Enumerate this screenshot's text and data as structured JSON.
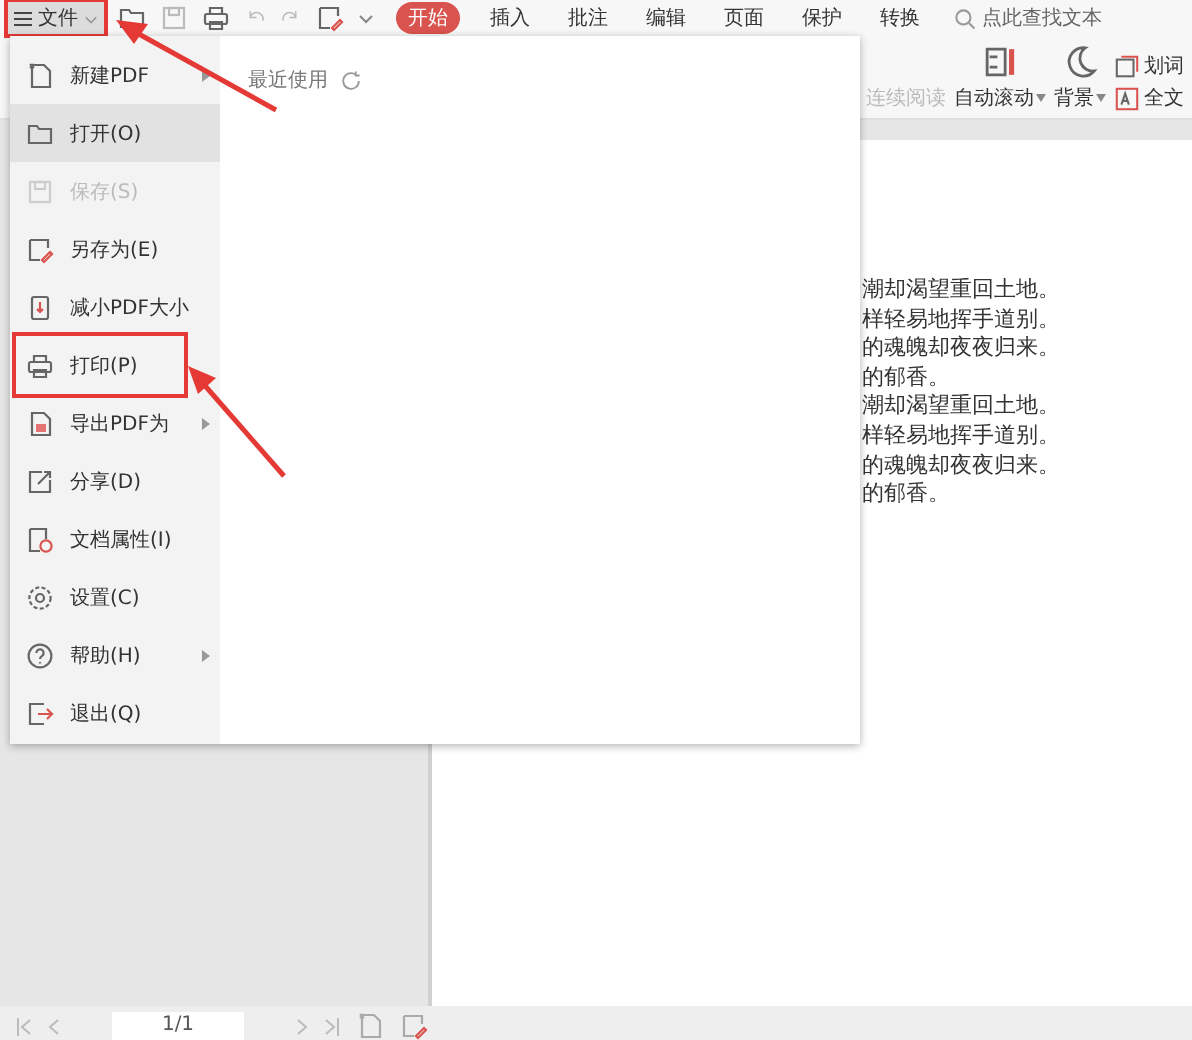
{
  "toolbar": {
    "file_button": {
      "label": "文件",
      "highlighted": true
    },
    "tabs": [
      {
        "label": "开始",
        "selected": true
      },
      {
        "label": "插入",
        "selected": false
      },
      {
        "label": "批注",
        "selected": false
      },
      {
        "label": "编辑",
        "selected": false
      },
      {
        "label": "页面",
        "selected": false
      },
      {
        "label": "保护",
        "selected": false
      },
      {
        "label": "转换",
        "selected": false
      }
    ],
    "search": {
      "placeholder": "点此查找文本"
    }
  },
  "ribbon": {
    "items": [
      {
        "label": "连续阅读",
        "kind": "continuous",
        "disabled": true,
        "dropdown": false
      },
      {
        "label": "自动滚动",
        "kind": "autoscroll",
        "disabled": false,
        "dropdown": true
      },
      {
        "label": "背景",
        "kind": "background",
        "disabled": false,
        "dropdown": true
      },
      {
        "label": "划词",
        "kind": "translate",
        "disabled": false,
        "dropdown": false
      },
      {
        "label": "全文",
        "kind": "fulltext",
        "disabled": false,
        "dropdown": false
      }
    ]
  },
  "file_menu": {
    "items": [
      {
        "label": "新建PDF",
        "kind": "new",
        "submenu": true,
        "selected": false,
        "disabled": false,
        "highlighted": false
      },
      {
        "label": "打开(O)",
        "kind": "open",
        "submenu": false,
        "selected": true,
        "disabled": false,
        "highlighted": false
      },
      {
        "label": "保存(S)",
        "kind": "save",
        "submenu": false,
        "selected": false,
        "disabled": true,
        "highlighted": false
      },
      {
        "label": "另存为(E)",
        "kind": "saveas",
        "submenu": false,
        "selected": false,
        "disabled": false,
        "highlighted": false
      },
      {
        "label": "减小PDF大小",
        "kind": "compress",
        "submenu": false,
        "selected": false,
        "disabled": false,
        "highlighted": false
      },
      {
        "label": "打印(P)",
        "kind": "print",
        "submenu": false,
        "selected": false,
        "disabled": false,
        "highlighted": true
      },
      {
        "label": "导出PDF为",
        "kind": "export",
        "submenu": true,
        "selected": false,
        "disabled": false,
        "highlighted": false
      },
      {
        "label": "分享(D)",
        "kind": "share",
        "submenu": false,
        "selected": false,
        "disabled": false,
        "highlighted": false
      },
      {
        "label": "文档属性(I)",
        "kind": "properties",
        "submenu": false,
        "selected": false,
        "disabled": false,
        "highlighted": false
      },
      {
        "label": "设置(C)",
        "kind": "settings",
        "submenu": false,
        "selected": false,
        "disabled": false,
        "highlighted": false
      },
      {
        "label": "帮助(H)",
        "kind": "help",
        "submenu": true,
        "selected": false,
        "disabled": false,
        "highlighted": false
      },
      {
        "label": "退出(Q)",
        "kind": "exit",
        "submenu": false,
        "selected": false,
        "disabled": false,
        "highlighted": false
      }
    ],
    "recent": {
      "title": "最近使用"
    }
  },
  "document": {
    "lines": [
      "潮却渴望重回土地。",
      "样轻易地挥手道别。",
      "的魂魄却夜夜归来。",
      "的郁香。",
      "潮却渴望重回土地。",
      "样轻易地挥手道别。",
      "的魂魄却夜夜归来。",
      "的郁香。"
    ]
  },
  "pager": {
    "page": "1/1"
  }
}
